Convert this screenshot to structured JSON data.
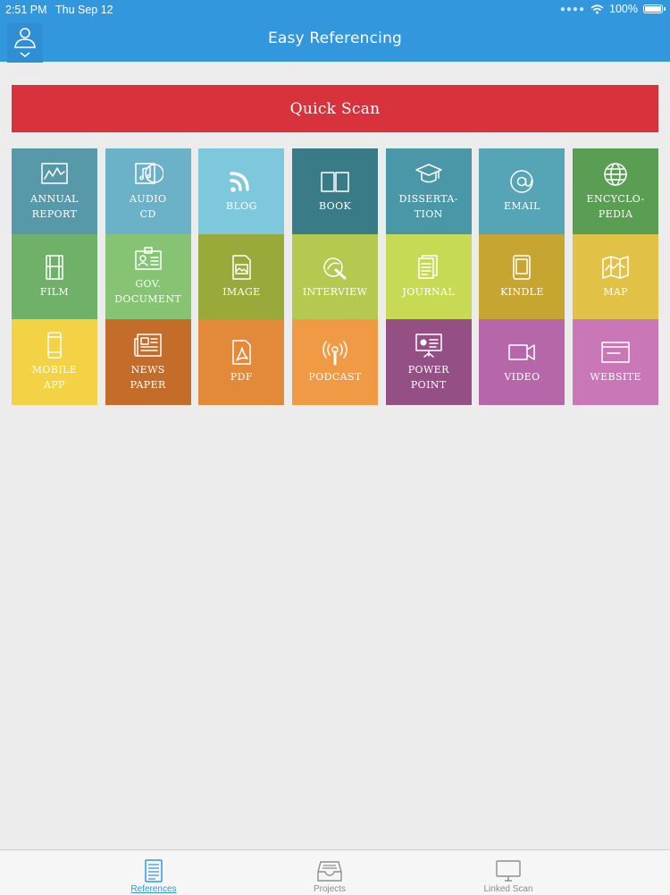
{
  "status_bar": {
    "time": "2:51 PM",
    "date": "Thu Sep 12",
    "battery": "100%"
  },
  "header": {
    "title": "Easy Referencing",
    "profile_icon": "user-icon",
    "dropdown_icon": "chevron-down-icon",
    "color": "#3397de"
  },
  "quick_scan": {
    "label": "Quick Scan",
    "color": "#d8323c"
  },
  "tiles": [
    {
      "label": "ANNUAL\nREPORT",
      "icon": "chart-icon",
      "color": "#5799a9"
    },
    {
      "label": "AUDIO\nCD",
      "icon": "audio-cd-icon",
      "color": "#6bb1c7"
    },
    {
      "label": "BLOG",
      "icon": "rss-icon",
      "color": "#7ec8de"
    },
    {
      "label": "BOOK",
      "icon": "book-icon",
      "color": "#397b87"
    },
    {
      "label": "DISSERTA-\nTION",
      "icon": "graduation-cap-icon",
      "color": "#4a97a7"
    },
    {
      "label": "EMAIL",
      "icon": "at-sign-icon",
      "color": "#56a5b7"
    },
    {
      "label": "ENCYCLO-\nPEDIA",
      "icon": "globe-icon",
      "color": "#5a9e54"
    },
    {
      "label": "FILM",
      "icon": "film-icon",
      "color": "#6fb168"
    },
    {
      "label": "GOV.\nDOCUMENT",
      "icon": "id-card-icon",
      "color": "#86c372"
    },
    {
      "label": "IMAGE",
      "icon": "image-file-icon",
      "color": "#9aaa3a"
    },
    {
      "label": "INTERVIEW",
      "icon": "interview-icon",
      "color": "#b5c84f"
    },
    {
      "label": "JOURNAL",
      "icon": "journal-icon",
      "color": "#c8d954"
    },
    {
      "label": "KINDLE",
      "icon": "tablet-icon",
      "color": "#c6a631"
    },
    {
      "label": "MAP",
      "icon": "map-icon",
      "color": "#e2c246"
    },
    {
      "label": "MOBILE\nAPP",
      "icon": "mobile-icon",
      "color": "#f3d245"
    },
    {
      "label": "NEWS\nPAPER",
      "icon": "newspaper-icon",
      "color": "#c46c2a"
    },
    {
      "label": "PDF",
      "icon": "pdf-icon",
      "color": "#e2893a"
    },
    {
      "label": "PODCAST",
      "icon": "podcast-icon",
      "color": "#f19a46"
    },
    {
      "label": "POWER\nPOINT",
      "icon": "presentation-icon",
      "color": "#944f85"
    },
    {
      "label": "VIDEO",
      "icon": "video-camera-icon",
      "color": "#b667a9"
    },
    {
      "label": "WEBSITE",
      "icon": "browser-window-icon",
      "color": "#c977b6"
    }
  ],
  "tabbar": [
    {
      "label": "References",
      "icon": "references-icon",
      "active": true
    },
    {
      "label": "Projects",
      "icon": "inbox-tray-icon",
      "active": false
    },
    {
      "label": "Linked Scan",
      "icon": "monitor-icon",
      "active": false
    }
  ]
}
